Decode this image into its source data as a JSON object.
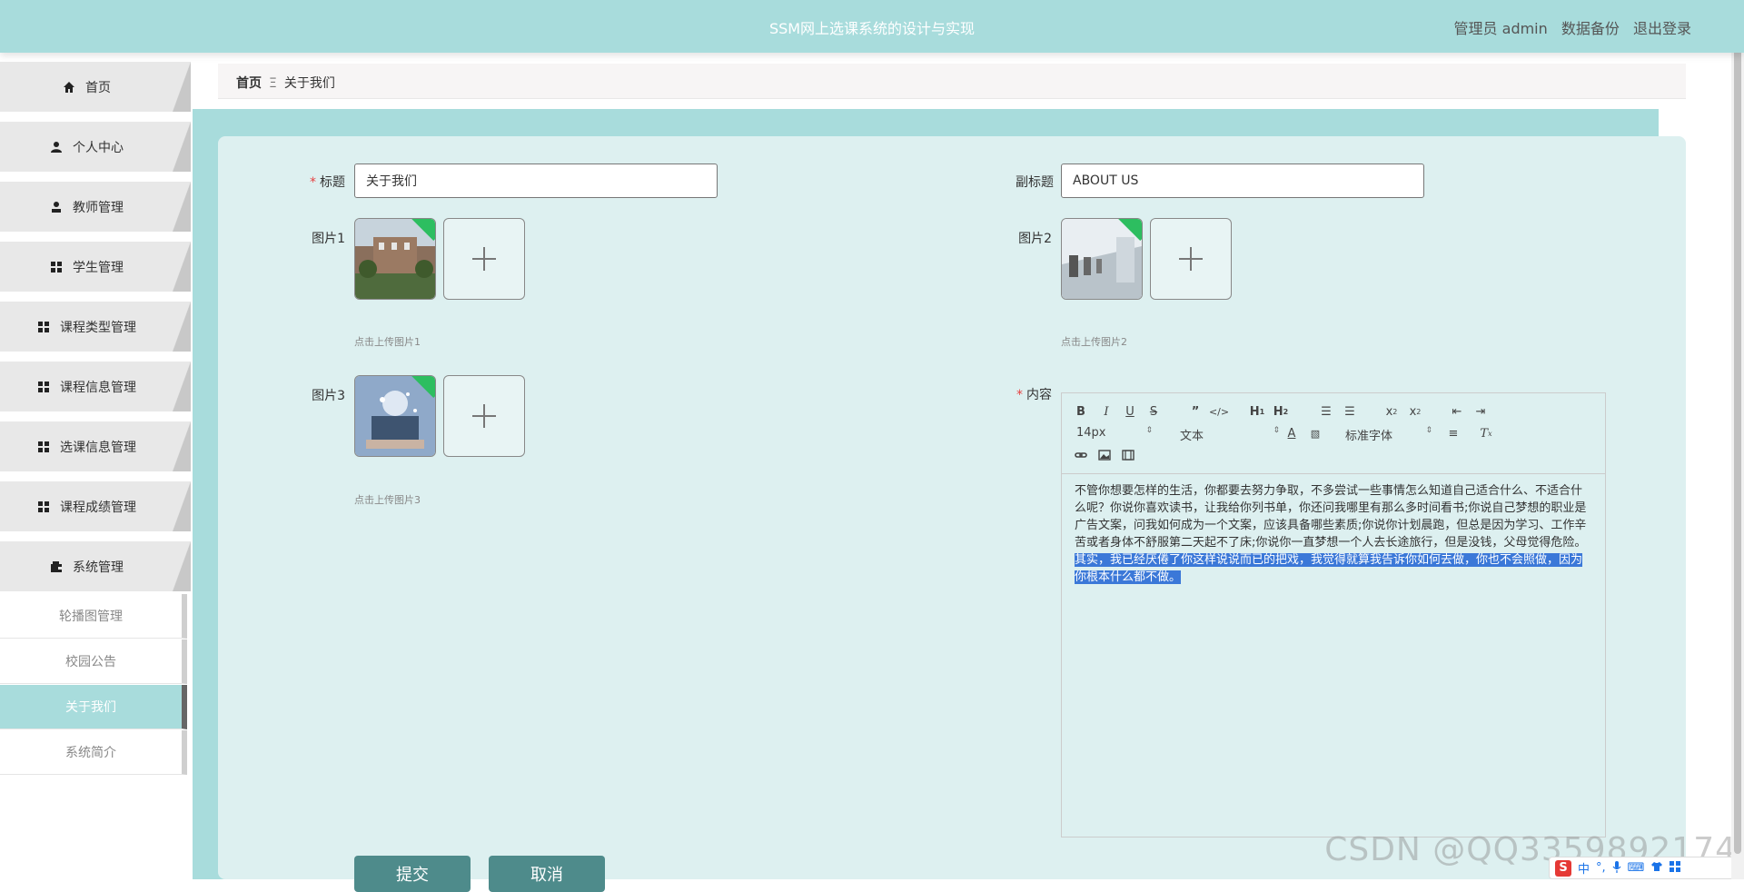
{
  "header": {
    "app_title": "SSM网上选课系统的设计与实现",
    "admin_label": "管理员 admin",
    "backup_label": "数据备份",
    "logout_label": "退出登录"
  },
  "sidebar": {
    "items": [
      {
        "label": "首页",
        "icon": "home-icon"
      },
      {
        "label": "个人中心",
        "icon": "user-icon"
      },
      {
        "label": "教师管理",
        "icon": "teacher-icon"
      },
      {
        "label": "学生管理",
        "icon": "grid-icon"
      },
      {
        "label": "课程类型管理",
        "icon": "grid-icon"
      },
      {
        "label": "课程信息管理",
        "icon": "grid-icon"
      },
      {
        "label": "选课信息管理",
        "icon": "grid-icon"
      },
      {
        "label": "课程成绩管理",
        "icon": "grid-icon"
      },
      {
        "label": "系统管理",
        "icon": "wallet-icon"
      }
    ],
    "submenu": [
      {
        "label": "轮播图管理"
      },
      {
        "label": "校园公告"
      },
      {
        "label": "关于我们",
        "active": true
      },
      {
        "label": "系统简介"
      }
    ]
  },
  "breadcrumb": {
    "home": "首页",
    "separator": "Ξ",
    "current": "关于我们"
  },
  "form": {
    "title_label": "标题",
    "title_value": "关于我们",
    "subtitle_label": "副标题",
    "subtitle_value": "ABOUT US",
    "pic1_label": "图片1",
    "pic1_hint": "点击上传图片1",
    "pic2_label": "图片2",
    "pic2_hint": "点击上传图片2",
    "pic3_label": "图片3",
    "pic3_hint": "点击上传图片3",
    "content_label": "内容",
    "submit_label": "提交",
    "cancel_label": "取消"
  },
  "editor": {
    "font_size": "14px",
    "paragraph_type": "文本",
    "font_family": "标准字体",
    "text_normal": "不管你想要怎样的生活，你都要去努力争取，不多尝试一些事情怎么知道自己适合什么、不适合什么呢？你说你喜欢读书，让我给你列书单，你还问我哪里有那么多时间看书;你说自己梦想的职业是广告文案，问我如何成为一个文案，应该具备哪些素质;你说你计划晨跑，但总是因为学习、工作辛苦或者身体不舒服第二天起不了床;你说你一直梦想一个人去长途旅行，但是没钱，父母觉得危险。",
    "text_selected": "其实，我已经厌倦了你这样说说而已的把戏，我觉得就算我告诉你如何去做，你也不会照做，因为你根本什么都不做。"
  },
  "overlay": {
    "watermark": "CSDN @QQ3359892174",
    "ime_lang": "中"
  }
}
